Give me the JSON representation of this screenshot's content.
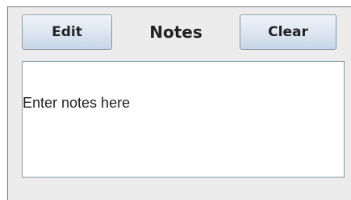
{
  "toolbar": {
    "edit_label": "Edit",
    "title": "Notes",
    "clear_label": "Clear"
  },
  "notes": {
    "text": "Enter notes here"
  }
}
